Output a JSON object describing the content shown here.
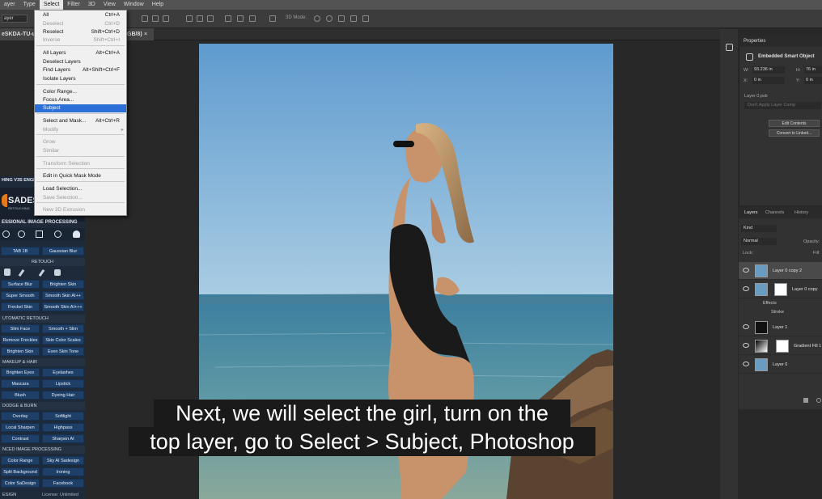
{
  "menubar": {
    "items": [
      "ayer",
      "Type",
      "Select",
      "Filter",
      "3D",
      "View",
      "Window",
      "Help"
    ],
    "active": "Select"
  },
  "optionsbar": {
    "layer_dropdown": "ayer",
    "mode_label": "3D Mode:"
  },
  "document": {
    "tab_title": "eSKDA-TU-um",
    "tab_suffix": "GB/8)"
  },
  "select_menu": {
    "items": [
      {
        "label": "All",
        "shortcut": "Ctrl+A",
        "disabled": false
      },
      {
        "label": "Deselect",
        "shortcut": "Ctrl+D",
        "disabled": true
      },
      {
        "label": "Reselect",
        "shortcut": "Shift+Ctrl+D",
        "disabled": false
      },
      {
        "label": "Inverse",
        "shortcut": "Shift+Ctrl+I",
        "disabled": true
      },
      {
        "label": "All Layers",
        "shortcut": "Alt+Ctrl+A",
        "disabled": false
      },
      {
        "label": "Deselect Layers",
        "shortcut": "",
        "disabled": false
      },
      {
        "label": "Find Layers",
        "shortcut": "Alt+Shift+Ctrl+F",
        "disabled": false
      },
      {
        "label": "Isolate Layers",
        "shortcut": "",
        "disabled": false
      },
      {
        "label": "Color Range...",
        "shortcut": "",
        "disabled": false
      },
      {
        "label": "Focus Area...",
        "shortcut": "",
        "disabled": false
      },
      {
        "label": "Subject",
        "shortcut": "",
        "disabled": false
      },
      {
        "label": "Select and Mask...",
        "shortcut": "Alt+Ctrl+R",
        "disabled": false
      },
      {
        "label": "Modify",
        "shortcut": "",
        "disabled": true
      },
      {
        "label": "Grow",
        "shortcut": "",
        "disabled": true
      },
      {
        "label": "Similar",
        "shortcut": "",
        "disabled": true
      },
      {
        "label": "Transform Selection",
        "shortcut": "",
        "disabled": true
      },
      {
        "label": "Edit in Quick Mask Mode",
        "shortcut": "",
        "disabled": false
      },
      {
        "label": "Load Selection...",
        "shortcut": "",
        "disabled": false
      },
      {
        "label": "Save Selection...",
        "shortcut": "",
        "disabled": true
      },
      {
        "label": "New 3D Extrusion",
        "shortcut": "",
        "disabled": true
      }
    ]
  },
  "plugin": {
    "top_title": "HING V3S ENGI",
    "brand": "SADES",
    "brand_sub": "RETOUCHING",
    "subtitle": "ESSIONAL IMAGE PROCESSING",
    "tab_label": "TAB 1B",
    "gaussian": "Gaussian Blur",
    "sections": {
      "retouch": "RETOUCH",
      "automatic": "UTOMATIC RETOUCH",
      "makeup": "MAKEUP & HAIR",
      "dodge": "DODGE & BURN",
      "advanced": "NCED IMAGE PROCESSING",
      "footer_left": "ESIGN",
      "footer_right": "License: Unlimited"
    },
    "buttons": {
      "surface_blur": "Surface Blur",
      "brighten_skin": "Brighten Skin",
      "super_smooth": "Super Smooth Skin",
      "smooth_skin_aipp": "Smooth Skin AI++",
      "freckles_skin": "Freckel Skin",
      "smooth_skin_aippp": "Smooth Skin AI+++",
      "slim_face": "Slim Face",
      "smooth_slim": "Smooth + Slim",
      "remove_freckles": "Remove Freckles",
      "skin_color_scales": "Skin Color Scales",
      "brighten_skin2": "Brighten Skin",
      "even_skin_tone": "Even Skin Tone",
      "brighten_eyes": "Brighten Eyes",
      "eyelashes": "Eyelashes",
      "mascara": "Mascara",
      "lipstick": "Lipstick",
      "blush": "Blush",
      "dyeing_hair": "Dyeing Hair",
      "overlay": "Overlay",
      "softlight": "Softlight",
      "local_sharpen": "Local Sharpen",
      "highpass": "Highpass",
      "contrast": "Contrast",
      "sharpen_ai": "Sharpen AI",
      "color_range": "Color Range",
      "sky_ai": "Sky AI Sadesign",
      "split_background": "Split Background",
      "ironing": "Ironing",
      "color_sadesign": "Color SaDesign",
      "facebook": "Facebook"
    }
  },
  "properties": {
    "title": "Properties",
    "object_type": "Embedded Smart Object",
    "w_label": "W:",
    "w_value": "93.236 in",
    "h_label": "H:",
    "h_value": "76 in",
    "x_label": "X:",
    "x_value": "0 in",
    "y_label": "Y:",
    "y_value": "0 in",
    "file": "Layer 0.psb",
    "comp": "Don't Apply Layer Comp",
    "edit_contents": "Edit Contents",
    "convert_linked": "Convert to Linked..."
  },
  "layers_panel": {
    "tabs": [
      "Layers",
      "Channels",
      "History"
    ],
    "kind": "Kind",
    "blend_mode": "Normal",
    "opacity_label": "Opacity:",
    "lock_label": "Lock:",
    "fill_label": "Fill:",
    "layers": [
      {
        "name": "Layer 0 copy 2",
        "selected": true
      },
      {
        "name": "Layer 0 copy",
        "selected": false
      },
      {
        "name": "Effects",
        "selected": false
      },
      {
        "name": "Stroke",
        "selected": false
      },
      {
        "name": "Layer 1",
        "selected": false
      },
      {
        "name": "Gradient Fill 1",
        "selected": false
      },
      {
        "name": "Layer 0",
        "selected": false
      }
    ]
  },
  "caption": {
    "line1": "Next, we will select the girl, turn on the",
    "line2": "top layer, go to Select > Subject, Photoshop"
  }
}
